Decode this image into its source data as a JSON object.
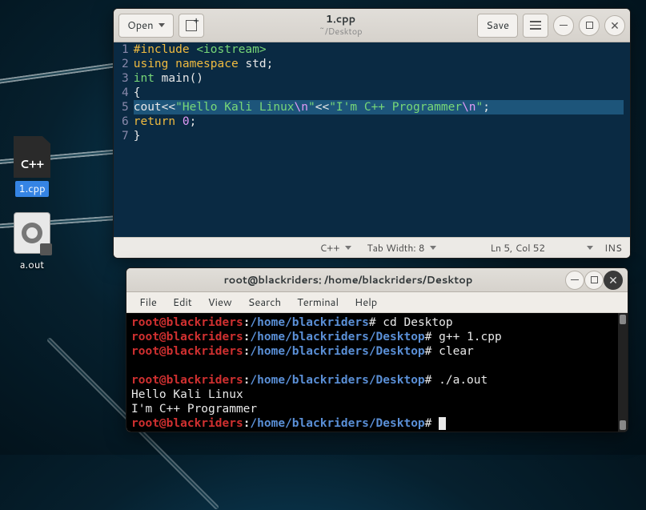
{
  "desktop": {
    "icons": [
      {
        "label": "1.cpp",
        "kind": "cpp",
        "selected": true
      },
      {
        "label": "a.out",
        "kind": "exec",
        "selected": false
      }
    ]
  },
  "editor": {
    "headerbar": {
      "open_label": "Open",
      "title": "1.cpp",
      "subtitle": "~/Desktop",
      "save_label": "Save"
    },
    "code": {
      "lines": [
        {
          "n": 1,
          "tokens": [
            [
              "pre",
              "#include "
            ],
            [
              "inc-str",
              "<iostream>"
            ]
          ]
        },
        {
          "n": 2,
          "tokens": [
            [
              "include",
              "using "
            ],
            [
              "ns",
              "namespace "
            ],
            [
              "punc",
              "std;"
            ]
          ]
        },
        {
          "n": 3,
          "tokens": [
            [
              "type",
              "int "
            ],
            [
              "punc",
              "main()"
            ]
          ]
        },
        {
          "n": 4,
          "tokens": [
            [
              "punc",
              "{"
            ]
          ]
        },
        {
          "n": 5,
          "hl": true,
          "tokens": [
            [
              "punc",
              "cout<<"
            ],
            [
              "str",
              "\"Hello Kali Linux"
            ],
            [
              "esc",
              "\\n"
            ],
            [
              "str",
              "\""
            ],
            [
              "punc",
              "<<"
            ],
            [
              "str",
              "\"I'm C++ Programmer"
            ],
            [
              "esc",
              "\\n"
            ],
            [
              "str",
              "\""
            ],
            [
              "punc",
              ";"
            ]
          ]
        },
        {
          "n": 6,
          "tokens": [
            [
              "include",
              "return "
            ],
            [
              "num",
              "0"
            ],
            [
              "punc",
              ";"
            ]
          ]
        },
        {
          "n": 7,
          "tokens": [
            [
              "punc",
              "}"
            ]
          ]
        }
      ]
    },
    "statusbar": {
      "language": "C++",
      "tabwidth": "Tab Width: 8",
      "cursor": "Ln 5, Col 52",
      "insert_mode": "INS"
    }
  },
  "terminal": {
    "title": "root@blackriders: /home/blackriders/Desktop",
    "menu": [
      "File",
      "Edit",
      "View",
      "Search",
      "Terminal",
      "Help"
    ],
    "prompt": {
      "user": "root@blackriders",
      "home_path": "/home/blackriders",
      "desktop_path": "/home/blackriders/Desktop"
    },
    "lines": [
      {
        "type": "prompt",
        "path": "home",
        "cmd": "cd Desktop"
      },
      {
        "type": "prompt",
        "path": "desktop",
        "cmd": "g++ 1.cpp"
      },
      {
        "type": "prompt",
        "path": "desktop",
        "cmd": "clear"
      },
      {
        "type": "blank"
      },
      {
        "type": "prompt",
        "path": "desktop",
        "cmd": "./a.out"
      },
      {
        "type": "output",
        "text": "Hello Kali Linux"
      },
      {
        "type": "output",
        "text": "I'm C++ Programmer"
      },
      {
        "type": "prompt",
        "path": "desktop",
        "cmd": "",
        "cursor": true
      }
    ]
  }
}
